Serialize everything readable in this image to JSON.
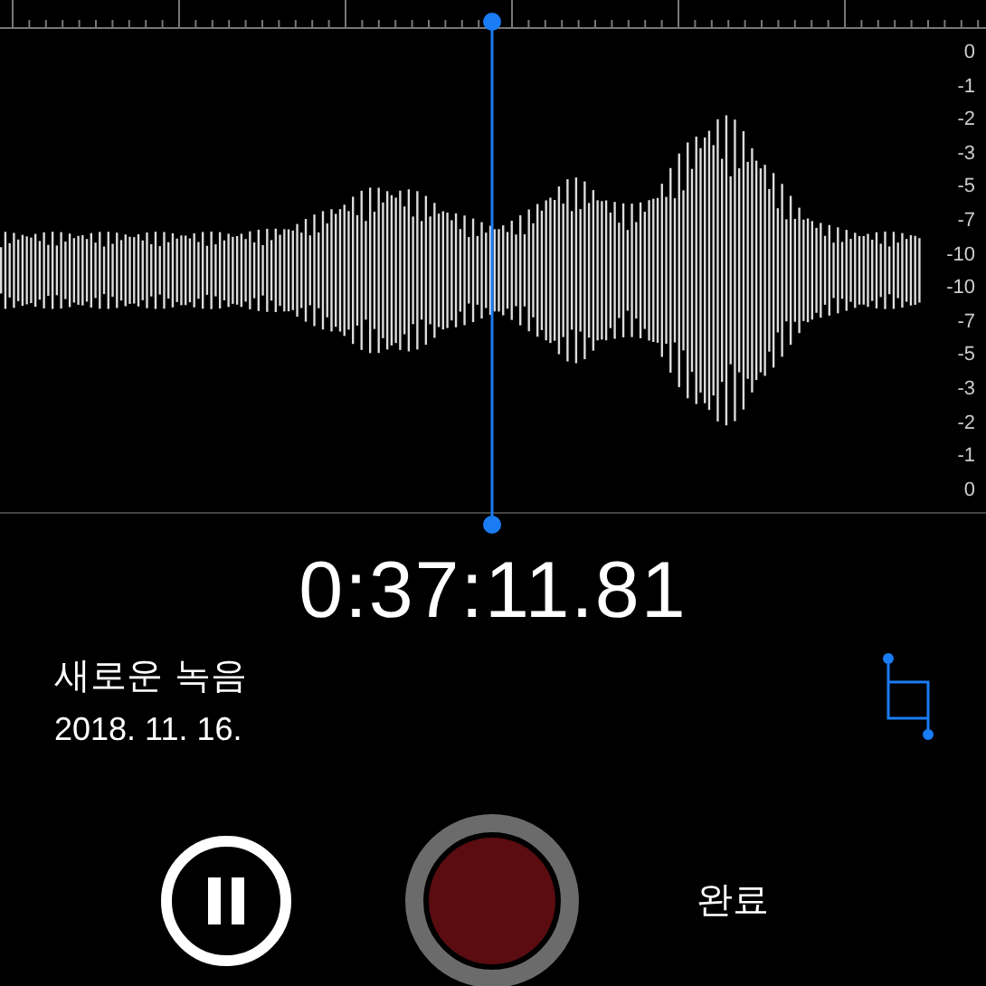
{
  "scale_labels": [
    "0",
    "-1",
    "-2",
    "-3",
    "-5",
    "-7",
    "-10",
    "-10",
    "-7",
    "-5",
    "-3",
    "-2",
    "-1",
    "0"
  ],
  "elapsed": "0:37:11.81",
  "recording": {
    "title": "새로운 녹음",
    "date": "2018. 11. 16."
  },
  "controls": {
    "paused": false,
    "done_label": "완료"
  }
}
